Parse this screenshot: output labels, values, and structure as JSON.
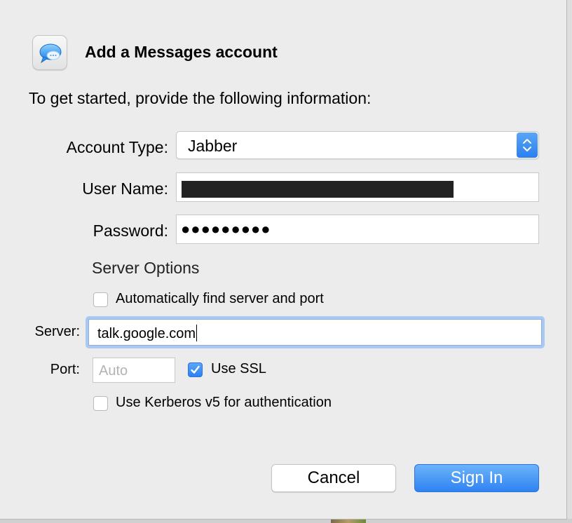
{
  "dialog": {
    "title": "Add a Messages account",
    "intro": "To get started, provide the following information:",
    "app_icon": "messages-app-icon"
  },
  "form": {
    "account_type_label": "Account Type:",
    "account_type_value": "Jabber",
    "user_name_label": "User Name:",
    "user_name_value": "[redacted]",
    "password_label": "Password:",
    "password_value": "●●●●●●●●●"
  },
  "server_options": {
    "heading": "Server Options",
    "auto_find_label": "Automatically find server and port",
    "auto_find_checked": false,
    "server_label": "Server:",
    "server_value": "talk.google.com",
    "port_label": "Port:",
    "port_placeholder": "Auto",
    "use_ssl_label": "Use SSL",
    "use_ssl_checked": true,
    "kerberos_label": "Use Kerberos v5 for authentication",
    "kerberos_checked": false
  },
  "buttons": {
    "cancel_label": "Cancel",
    "sign_in_label": "Sign In"
  },
  "colors": {
    "accent": "#2f83f2",
    "dialog_background": "#ececec",
    "focus_ring": "#a9c9f3"
  }
}
